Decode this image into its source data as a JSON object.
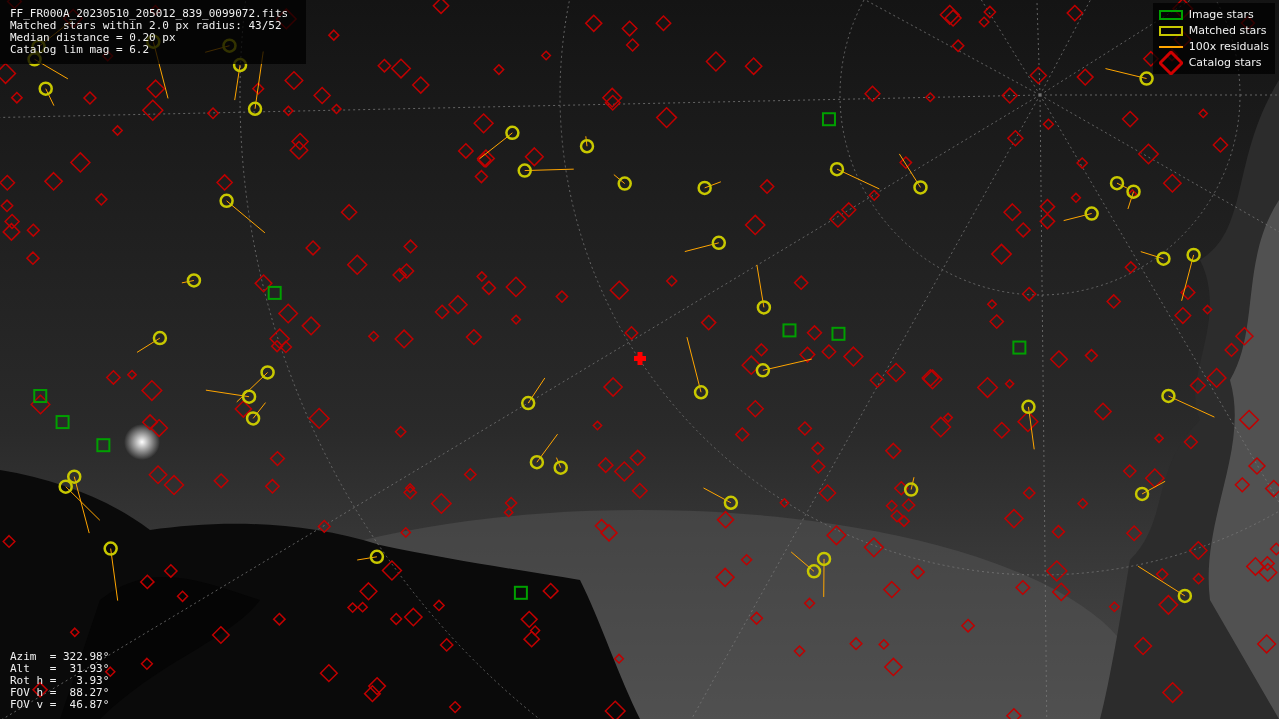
{
  "info_panel": {
    "lines": [
      "FF_FR000A_20230510_205012_839_0099072.fits",
      "Matched stars within 2.0 px radius: 43/52",
      "Median distance = 0.20 px",
      "Catalog lim mag = 6.2"
    ]
  },
  "legend": [
    {
      "label": "Image stars",
      "color": "#00a000"
    },
    {
      "kind": "matched",
      "label": "Matched stars",
      "color": "#c8c800"
    },
    {
      "kind": "residual",
      "label": "100x residuals",
      "color": "#ffa500"
    },
    {
      "kind": "catalog",
      "label": "Catalog stars",
      "color": "#d00000"
    }
  ],
  "pointing": {
    "lines": [
      "Azim  = 322.98°",
      "Alt   =  31.93°",
      "Rot h =   3.93°",
      "FOV h =  88.27°",
      "FOV v =  46.87°"
    ]
  }
}
